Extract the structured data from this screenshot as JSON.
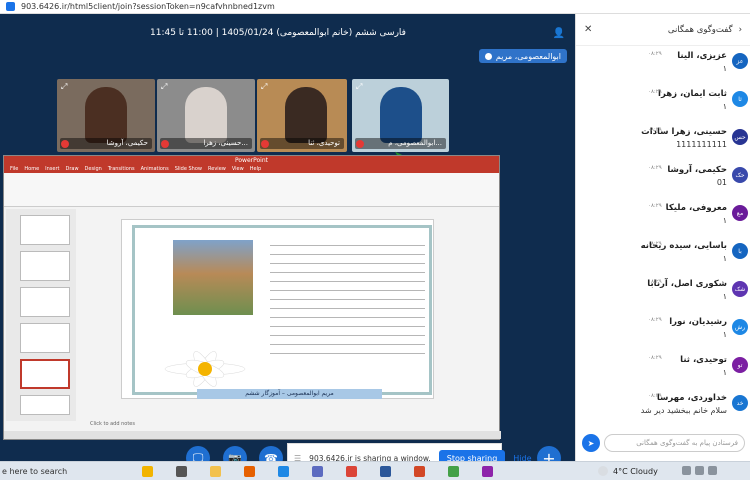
{
  "browser": {
    "url": "903.6426.ir/html5client/join?sessionToken=n9cafvhnbned1zvm"
  },
  "meeting": {
    "title": "فارسی ششم (خانم ابوالمعصومی) 1405/01/24 | 11:00 تا 11:45",
    "presenter": "ابوالمعصومی، مریم",
    "cameras": [
      {
        "label": "حکیمی، آروشا"
      },
      {
        "label": "حسینی، زهرا..."
      },
      {
        "label": "توحیدی، ثنا"
      },
      {
        "label": "ابوالمعصومی، م..."
      }
    ]
  },
  "ppt": {
    "title_bar": "PowerPoint",
    "tabs": [
      "File",
      "Home",
      "Insert",
      "Draw",
      "Design",
      "Transitions",
      "Animations",
      "Slide Show",
      "Review",
      "View",
      "Help"
    ],
    "notes_placeholder": "Click to add notes",
    "slide_footer": "مریم ابوالمعصومی – آموزگار ششم"
  },
  "share": {
    "message": "903.6426.ir is sharing a window.",
    "stop_label": "Stop sharing",
    "hide_label": "Hide"
  },
  "chat": {
    "title": "گفت‌وگوی همگانی",
    "messages": [
      {
        "initials": "عز",
        "name": "عزیزی، الینا",
        "time": "۰۸:۲۹",
        "text": "۱",
        "color": "#1565c0"
      },
      {
        "initials": "ثا",
        "name": "ثابت ایمان، زهرا",
        "time": "۰۸:۲۹",
        "text": "۱",
        "color": "#1e88e5"
      },
      {
        "initials": "حس",
        "name": "حسینی، زهرا سادات",
        "time": "۰۸:۲۹",
        "text": "1111111111",
        "color": "#283593"
      },
      {
        "initials": "حک",
        "name": "حکیمی، آروشا",
        "time": "۰۸:۲۹",
        "text": "01",
        "color": "#3949ab"
      },
      {
        "initials": "مع",
        "name": "معروفی، ملیکا",
        "time": "۰۸:۲۹",
        "text": "۱",
        "color": "#6a1b9a"
      },
      {
        "initials": "با",
        "name": "باسایی، سیده ریحانه",
        "time": "۰۸:۲۹",
        "text": "۱",
        "color": "#1565c0"
      },
      {
        "initials": "شک",
        "name": "شکوری اصل، آرنابا",
        "time": "۰۸:۲۹",
        "text": "۱",
        "color": "#5e35b1"
      },
      {
        "initials": "رش",
        "name": "رشیدیان، نورا",
        "time": "۰۸:۲۹",
        "text": "۱",
        "color": "#1e88e5"
      },
      {
        "initials": "تو",
        "name": "توحیدی، ثنا",
        "time": "۰۸:۲۹",
        "text": "۱",
        "color": "#7b1fa2"
      },
      {
        "initials": "خد",
        "name": "خداوردی، مهرسا",
        "time": "۰۸:۲۹",
        "text": "سلام خانم ببخشید دیر شد",
        "color": "#1976d2"
      }
    ],
    "input_placeholder": "فرستادن پیام به گفت‌وگوی همگانی"
  },
  "taskbar": {
    "search_text": "e here to search",
    "weather": "4°C  Cloudy",
    "icons": [
      {
        "name": "widgets",
        "color": "#f2b400"
      },
      {
        "name": "task-view",
        "color": "#555555"
      },
      {
        "name": "file-explorer",
        "color": "#f2c14e"
      },
      {
        "name": "firefox",
        "color": "#e66000"
      },
      {
        "name": "edge",
        "color": "#1e88e5"
      },
      {
        "name": "store",
        "color": "#5c6bc0"
      },
      {
        "name": "chrome",
        "color": "#db4437"
      },
      {
        "name": "word",
        "color": "#2b579a"
      },
      {
        "name": "powerpoint",
        "color": "#d24726"
      },
      {
        "name": "app1",
        "color": "#43a047"
      },
      {
        "name": "app2",
        "color": "#8e24aa"
      }
    ]
  }
}
